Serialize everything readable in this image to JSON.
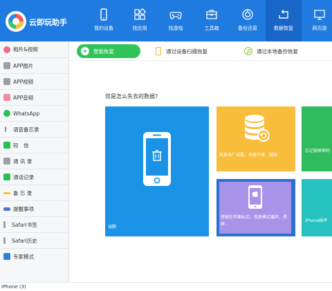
{
  "app": {
    "title": "云即玩助手"
  },
  "nav": [
    {
      "label": "我的设备",
      "icon": "phone-icon"
    },
    {
      "label": "找应用",
      "icon": "apps-icon"
    },
    {
      "label": "找游戏",
      "icon": "gamepad-icon"
    },
    {
      "label": "工具箱",
      "icon": "toolbox-icon"
    },
    {
      "label": "备份还原",
      "icon": "backup-icon"
    },
    {
      "label": "数据恢复",
      "icon": "recover-icon"
    },
    {
      "label": "网页游",
      "icon": "screen-icon"
    }
  ],
  "sidebar": {
    "items": [
      {
        "label": "相片&视频",
        "color": "#f06a8c"
      },
      {
        "label": "APP图片",
        "color": "#8a8a8a"
      },
      {
        "label": "APP视频",
        "color": "#8a8a8a"
      },
      {
        "label": "APP音频",
        "color": "#f38aa6"
      },
      {
        "label": "WhatsApp",
        "color": "#27c152"
      },
      {
        "label": "语音备忘录",
        "color": "#8a8a8a"
      },
      {
        "label": "短　信",
        "color": "#27c152"
      },
      {
        "label": "通 讯 录",
        "color": "#8a8a8a"
      },
      {
        "label": "通话记录",
        "color": "#27c152"
      },
      {
        "label": "备 忘 录",
        "color": "#f6c13d"
      },
      {
        "label": "提醒事项",
        "color": "#4a78d6"
      },
      {
        "label": "Safari书签",
        "color": "#8a8a8a"
      },
      {
        "label": "Safari历史",
        "color": "#8a8a8a"
      },
      {
        "label": "专家模式",
        "color": "#2f7fe0"
      }
    ]
  },
  "tabs": {
    "smart": "智能恢复",
    "device": "通过设备扫描恢复",
    "backup": "通过本地备份恢复"
  },
  "main": {
    "question": "您是怎么失去的数据?",
    "cards": {
      "mistake": "误删",
      "factory": "恢复出厂设置、系统升级、越狱",
      "forgot": "忘记锁屏密码",
      "broken": "停留在苹果标志、恢复模式循环、黑屏...",
      "itunes": "iPhone损坏"
    }
  },
  "status": {
    "device": "iPhone (3)"
  }
}
